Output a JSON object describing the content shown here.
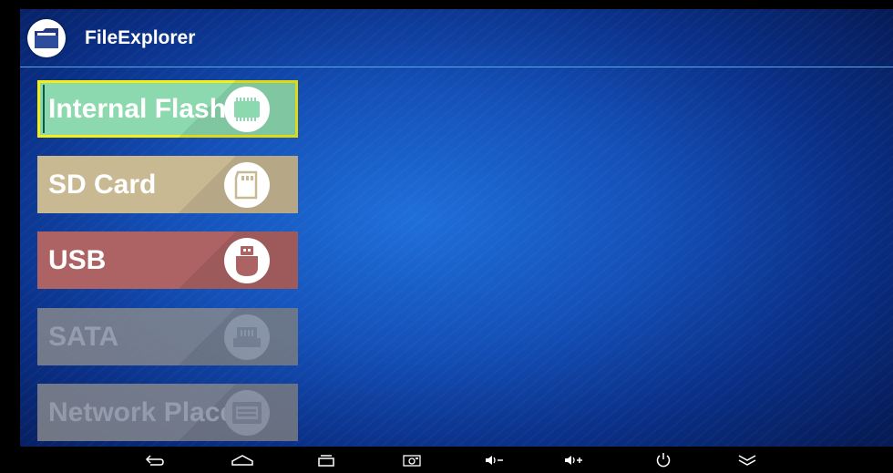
{
  "app": {
    "title": "FileExplorer",
    "icon": "folder-icon"
  },
  "storage_tiles": [
    {
      "label": "Internal Flash",
      "icon": "chip-icon",
      "color": "#8cd9b0",
      "state": "focused"
    },
    {
      "label": "SD Card",
      "icon": "sd-card-icon",
      "color": "#c8b993",
      "state": "enabled"
    },
    {
      "label": "USB",
      "icon": "usb-drive-icon",
      "color": "#ad6363",
      "state": "enabled"
    },
    {
      "label": "SATA",
      "icon": "sata-icon",
      "color": "#8c8c8c",
      "state": "disabled"
    },
    {
      "label": "Network Place",
      "icon": "network-drive-icon",
      "color": "#8c8c8c",
      "state": "disabled"
    }
  ],
  "focus_color": "#f5f011",
  "navbar": {
    "buttons": [
      "back-icon",
      "home-icon",
      "recent-apps-icon",
      "screenshot-icon",
      "volume-down-icon",
      "volume-up-icon",
      "power-icon",
      "collapse-icon"
    ]
  }
}
